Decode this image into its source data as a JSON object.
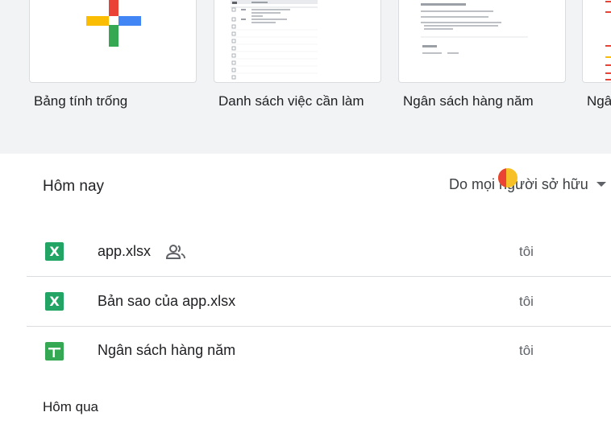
{
  "templates": [
    {
      "label": "Bảng tính trống"
    },
    {
      "label": "Danh sách việc cần làm"
    },
    {
      "label": "Ngân sách hàng năm"
    },
    {
      "label": "Ngâ"
    }
  ],
  "today_section": {
    "title": "Hôm nay"
  },
  "owner_filter": {
    "label": "Do mọi người sở hữu"
  },
  "files": [
    {
      "name": "app.xlsx",
      "owner": "tôi",
      "icon": "excel-file-icon",
      "shared": true
    },
    {
      "name": "Bản sao của app.xlsx",
      "owner": "tôi",
      "icon": "excel-file-icon",
      "shared": false
    },
    {
      "name": "Ngân sách hàng năm",
      "owner": "tôi",
      "icon": "sheets-file-icon",
      "shared": false
    }
  ],
  "yesterday_section": {
    "title": "Hôm qua"
  },
  "icons": {
    "excel_glyph": "X",
    "sheets_glyph": "+"
  },
  "colors": {
    "google_blue": "#4285f4",
    "google_red": "#ea4335",
    "google_yellow": "#fbbc04",
    "google_green": "#34a853",
    "excel_green": "#21a464"
  }
}
